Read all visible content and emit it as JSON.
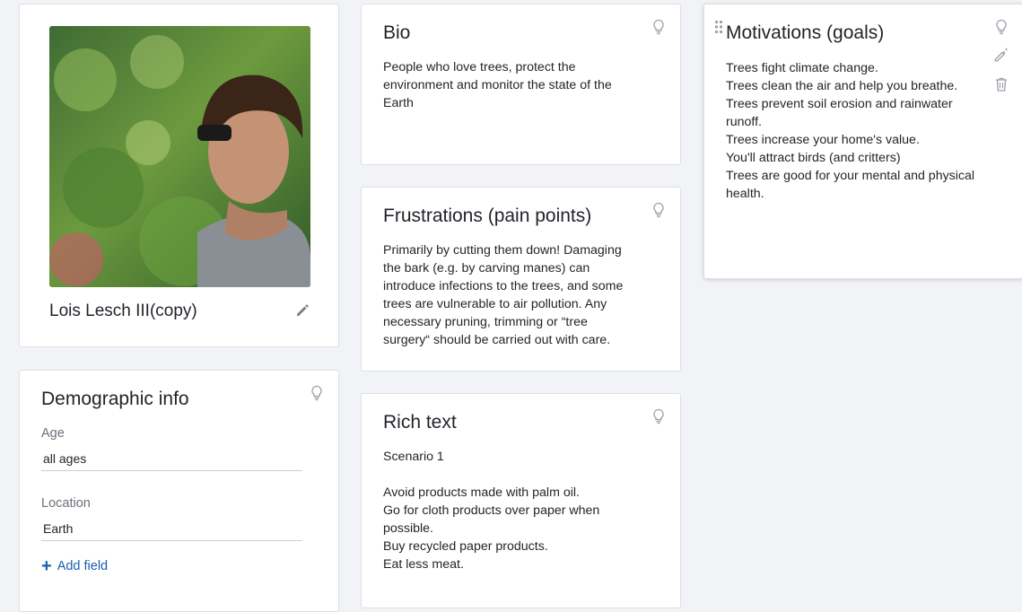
{
  "profile": {
    "name": "Lois Lesch III(copy)",
    "photo_alt": "profile photo"
  },
  "demographic": {
    "title": "Demographic info",
    "fields": [
      {
        "label": "Age",
        "value": "all ages"
      },
      {
        "label": "Location",
        "value": "Earth"
      }
    ],
    "add_field_label": "Add field"
  },
  "bio": {
    "title": "Bio",
    "lines": [
      "People who love trees, protect the",
      "environment and monitor the state of the",
      "Earth"
    ]
  },
  "frustrations": {
    "title": "Frustrations (pain points)",
    "lines": [
      "Primarily by cutting them down! Damaging",
      "the bark (e.g. by carving manes) can",
      "introduce infections to the trees, and some",
      "trees are vulnerable to air pollution. Any",
      "necessary pruning, trimming or “tree",
      "surgery“ should be carried out with care."
    ]
  },
  "richtext": {
    "title": "Rich text",
    "lines": [
      "Scenario 1",
      "",
      "Avoid products made with palm oil.",
      "Go for cloth products over paper when",
      "possible.",
      "Buy recycled paper products.",
      "Eat less meat."
    ]
  },
  "motivations": {
    "title": "Motivations (goals)",
    "lines": [
      "Trees fight climate change.",
      "Trees clean the air and help you breathe.",
      "Trees prevent soil erosion and rainwater",
      "runoff.",
      "Trees increase your home's value.",
      "You'll attract birds (and critters)",
      "Trees are good for your mental and physical",
      "health."
    ]
  },
  "icons": {
    "hint": "lightbulb-icon",
    "edit": "pencil-icon",
    "edit_magic": "magic-pencil-icon",
    "delete": "trash-icon",
    "drag": "drag-handle-icon",
    "add": "plus-icon"
  },
  "colors": {
    "background": "#f2f3f6",
    "card": "#ffffff",
    "border": "#dcdfe4",
    "link": "#1a5fb4",
    "muted": "#6b7079"
  }
}
